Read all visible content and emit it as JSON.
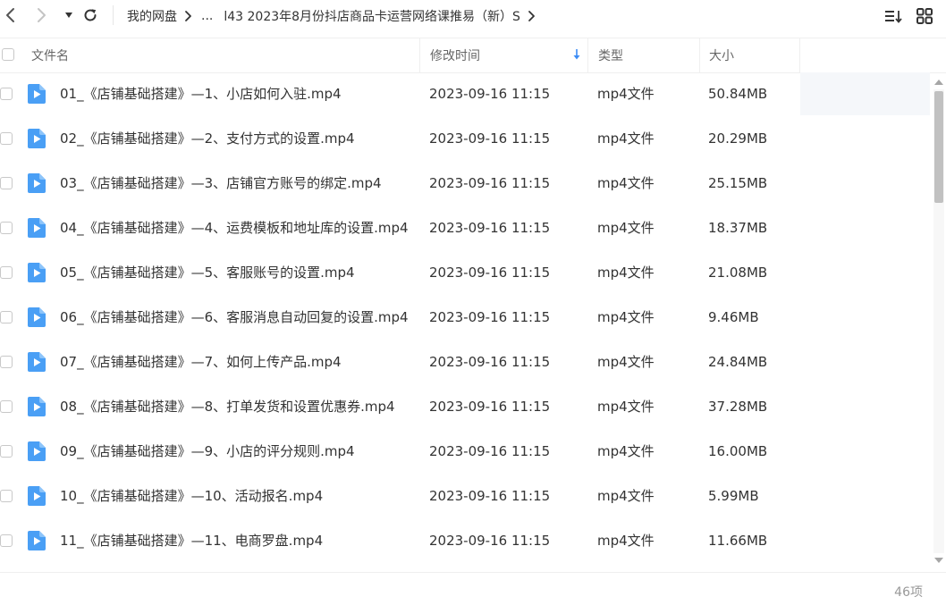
{
  "nav": {
    "back_icon": "chevron-left-icon",
    "forward_icon": "chevron-right-icon",
    "history_icon": "caret-down-icon",
    "refresh_icon": "refresh-icon"
  },
  "breadcrumb": {
    "root": "我的网盘",
    "ellipsis": "...",
    "current": "l43 2023年8月份抖店商品卡运营网络课推易（新）S"
  },
  "toolbar": {
    "sort_icon": "sort-list-icon",
    "grid_icon": "grid-view-icon"
  },
  "columns": {
    "name": "文件名",
    "mtime": "修改时间",
    "type": "类型",
    "size": "大小"
  },
  "colors": {
    "file_icon": "#4a9ff5",
    "sort_arrow": "#3b8bf5"
  },
  "files": [
    {
      "name": "01_《店铺基础搭建》—1、小店如何入驻.mp4",
      "mtime": "2023-09-16 11:15",
      "type": "mp4文件",
      "size": "50.84MB"
    },
    {
      "name": "02_《店铺基础搭建》—2、支付方式的设置.mp4",
      "mtime": "2023-09-16 11:15",
      "type": "mp4文件",
      "size": "20.29MB"
    },
    {
      "name": "03_《店铺基础搭建》—3、店铺官方账号的绑定.mp4",
      "mtime": "2023-09-16 11:15",
      "type": "mp4文件",
      "size": "25.15MB"
    },
    {
      "name": "04_《店铺基础搭建》—4、运费模板和地址库的设置.mp4",
      "mtime": "2023-09-16 11:15",
      "type": "mp4文件",
      "size": "18.37MB"
    },
    {
      "name": "05_《店铺基础搭建》—5、客服账号的设置.mp4",
      "mtime": "2023-09-16 11:15",
      "type": "mp4文件",
      "size": "21.08MB"
    },
    {
      "name": "06_《店铺基础搭建》—6、客服消息自动回复的设置.mp4",
      "mtime": "2023-09-16 11:15",
      "type": "mp4文件",
      "size": "9.46MB"
    },
    {
      "name": "07_《店铺基础搭建》—7、如何上传产品.mp4",
      "mtime": "2023-09-16 11:15",
      "type": "mp4文件",
      "size": "24.84MB"
    },
    {
      "name": "08_《店铺基础搭建》—8、打单发货和设置优惠券.mp4",
      "mtime": "2023-09-16 11:15",
      "type": "mp4文件",
      "size": "37.28MB"
    },
    {
      "name": "09_《店铺基础搭建》—9、小店的评分规则.mp4",
      "mtime": "2023-09-16 11:15",
      "type": "mp4文件",
      "size": "16.00MB"
    },
    {
      "name": "10_《店铺基础搭建》—10、活动报名.mp4",
      "mtime": "2023-09-16 11:15",
      "type": "mp4文件",
      "size": "5.99MB"
    },
    {
      "name": "11_《店铺基础搭建》—11、电商罗盘.mp4",
      "mtime": "2023-09-16 11:15",
      "type": "mp4文件",
      "size": "11.66MB"
    }
  ],
  "footer": {
    "item_count": "46项"
  }
}
